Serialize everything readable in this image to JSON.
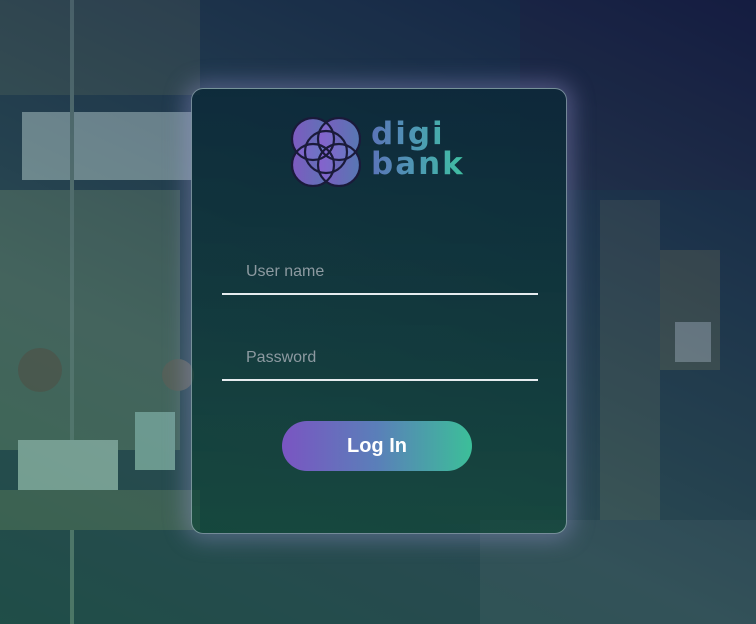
{
  "brand": {
    "name_line1": "digi",
    "name_line2": "bank",
    "logo_icon": "overlapping-circles-icon",
    "colors": {
      "purple": "#7a55c2",
      "blue": "#5a7fb9",
      "teal": "#3cbf99"
    }
  },
  "form": {
    "username_placeholder": "User name",
    "username_value": "",
    "password_placeholder": "Password",
    "password_value": "",
    "submit_label": "Log In"
  },
  "background": {
    "description_colors": [
      "#146e46",
      "#0f2d50",
      "#0c1450"
    ]
  }
}
